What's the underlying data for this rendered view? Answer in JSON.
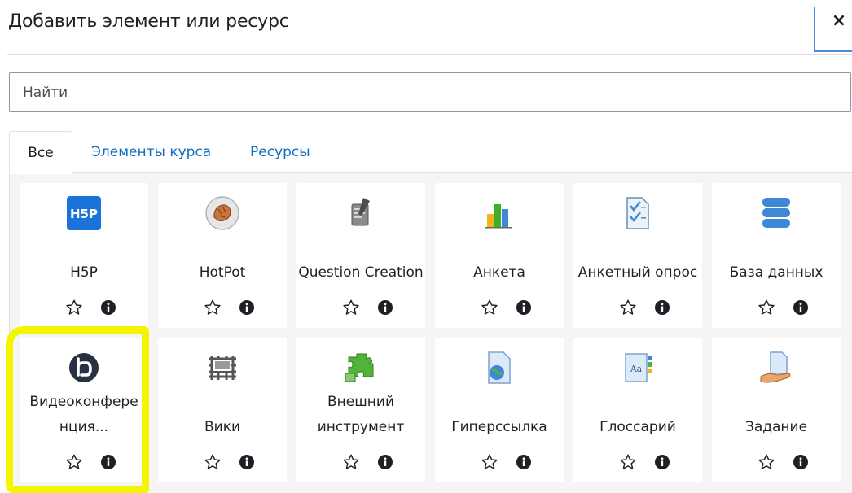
{
  "modal": {
    "title": "Добавить элемент или ресурс",
    "close_label": "×"
  },
  "search": {
    "placeholder": "Найти",
    "value": ""
  },
  "tabs": [
    {
      "label": "Все",
      "active": true
    },
    {
      "label": "Элементы курса",
      "active": false
    },
    {
      "label": "Ресурсы",
      "active": false
    }
  ],
  "modules": [
    {
      "label": "H5P",
      "icon": "h5p-icon"
    },
    {
      "label": "HotPot",
      "icon": "hotpot-icon"
    },
    {
      "label": "Question Creation",
      "icon": "question-creation-icon"
    },
    {
      "label": "Анкета",
      "icon": "questionnaire-icon"
    },
    {
      "label": "Анкетный опрос",
      "icon": "survey-icon"
    },
    {
      "label": "База данных",
      "icon": "database-icon"
    },
    {
      "label": "Видеоконфере нция...",
      "icon": "bigbluebutton-icon"
    },
    {
      "label": "Вики",
      "icon": "wiki-icon"
    },
    {
      "label": "Внешний инструмент",
      "icon": "external-tool-icon"
    },
    {
      "label": "Гиперссылка",
      "icon": "url-icon"
    },
    {
      "label": "Глоссарий",
      "icon": "glossary-icon"
    },
    {
      "label": "Задание",
      "icon": "assignment-icon"
    }
  ],
  "colors": {
    "link": "#0f6cbf",
    "highlight": "#f5f500",
    "h5p_blue": "#1a73d9"
  }
}
